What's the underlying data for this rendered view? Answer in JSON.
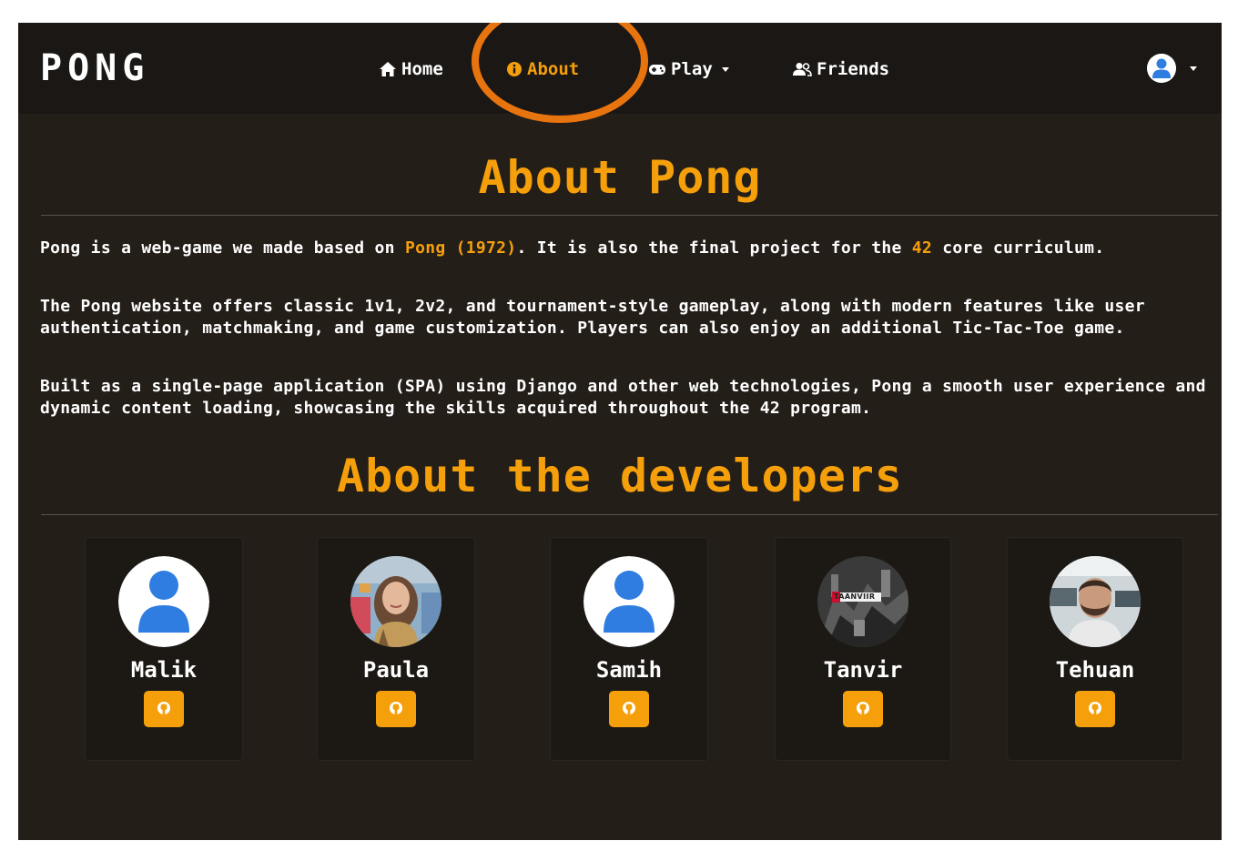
{
  "navbar": {
    "brand": "PONG",
    "items": [
      {
        "label": "Home",
        "icon": "home-icon"
      },
      {
        "label": "About",
        "icon": "info-icon",
        "active": true
      },
      {
        "label": "Play",
        "icon": "gamepad-icon",
        "dropdown": true
      },
      {
        "label": "Friends",
        "icon": "users-icon"
      }
    ],
    "user_menu": {
      "icon": "user-avatar-icon",
      "dropdown": true
    }
  },
  "about": {
    "title": "About Pong",
    "p1_before": "Pong is a web-game we made based on ",
    "p1_link1": "Pong (1972)",
    "p1_middle": ". It is also the final project for the ",
    "p1_link2": "42",
    "p1_after": " core curriculum.",
    "p2": "The Pong website offers classic 1v1, 2v2, and tournament-style gameplay, along with modern features like user authentication, matchmaking, and game customization. Players can also enjoy an additional Tic-Tac-Toe game.",
    "p3": "Built as a single-page application (SPA) using Django and other web technologies, Pong a smooth user experience and dynamic content loading, showcasing the skills acquired throughout the 42 program."
  },
  "developers": {
    "title": "About the developers",
    "list": [
      {
        "name": "Malik",
        "avatar": "default-user-avatar",
        "link_icon": "github-icon"
      },
      {
        "name": "Paula",
        "avatar": "photo-avatar",
        "link_icon": "github-icon"
      },
      {
        "name": "Samih",
        "avatar": "default-user-avatar",
        "link_icon": "github-icon"
      },
      {
        "name": "Tanvir",
        "avatar": "photo-avatar",
        "avatar_text": "TAANVIIR",
        "link_icon": "github-icon"
      },
      {
        "name": "Tehuan",
        "avatar": "photo-avatar",
        "link_icon": "github-icon"
      }
    ]
  },
  "colors": {
    "accent": "#f5a00b",
    "page_background": "#241e19",
    "navbar_background": "#1a1714",
    "annotation_circle": "#e8740f"
  }
}
